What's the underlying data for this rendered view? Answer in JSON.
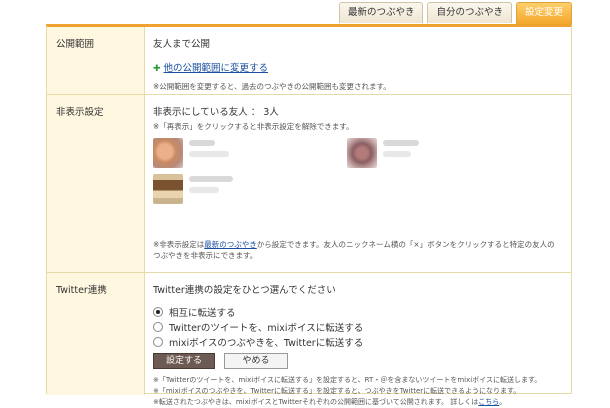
{
  "tabs": [
    {
      "label": "最新のつぶやき",
      "active": false
    },
    {
      "label": "自分のつぶやき",
      "active": false
    },
    {
      "label": "設定変更",
      "active": true
    }
  ],
  "visibility": {
    "label": "公開範囲",
    "current": "友人まで公開",
    "change_link": "他の公開範囲に変更する",
    "note": "※公開範囲を変更すると、過去のつぶやきの公開範囲も変更されます。"
  },
  "hidden": {
    "label": "非表示設定",
    "count_text": "非表示にしている友人 ： 3人",
    "hint": "※「再表示」をクリックすると非表示設定を解除できます。",
    "note_prefix": "※非表示設定は",
    "note_link": "最新のつぶやき",
    "note_suffix": "から設定できます。友人のニックネーム横の「×」ボタンをクリックすると特定の友人の",
    "note_line2": "つぶやきを非表示にできます。"
  },
  "twitter": {
    "label": "Twitter連携",
    "prompt": "Twitter連携の設定をひとつ選んでください",
    "options": [
      {
        "label": "相互に転送する",
        "selected": true
      },
      {
        "label": "Twitterのツイートを、mixiボイスに転送する",
        "selected": false
      },
      {
        "label": "mixiボイスのつぶやきを、Twitterに転送する",
        "selected": false
      }
    ],
    "save_label": "設定する",
    "cancel_label": "やめる",
    "notes": [
      "※「Twitterのツイートを、mixiボイスに転送する」を設定すると、RT・＠を含まないツイートをmixiボイスに転送します。",
      "※「mixiボイスのつぶやきを、Twitterに転送する」を設定すると、つぶやきをTwitterに転送できるようになります。"
    ],
    "note3_text": "※転送されたつぶやきは、mixiボイスとTwitterそれぞれの公開範囲に基づいて公開されます。 詳しくは",
    "note3_link": "こちら",
    "note3_end": "。"
  },
  "colors": {
    "accent": "#f0a22e",
    "label_bg": "#fff7e0",
    "link": "#1a4fa0"
  }
}
